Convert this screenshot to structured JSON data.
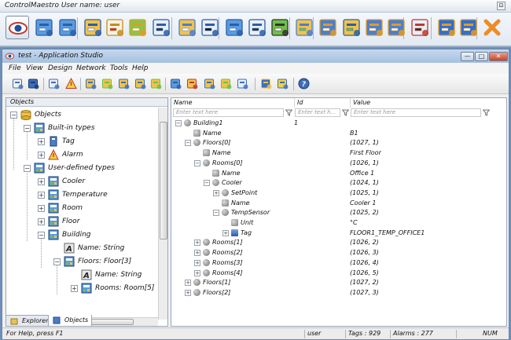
{
  "outer": {
    "title": "ControlMaestro User name: user",
    "close_glyph": "⊡",
    "toolbar_icons": [
      "eye-icon",
      "grid-icon",
      "grid-alt-icon",
      "monitor-icon",
      "document-icon",
      "chart-icon",
      "report-icon",
      "tag-add-icon",
      "database-icon",
      "server-icon",
      "list-icon",
      "module-icon",
      "component-icon",
      "network-icon",
      "table-icon",
      "user-icon",
      "users-icon",
      "settings-icon",
      "alert-user-icon",
      "lock-user-icon",
      "exit-icon"
    ]
  },
  "window": {
    "title": "test - Application Studio",
    "buttons": {
      "minimize": "—",
      "maximize": "□",
      "close": "✕"
    },
    "menu": [
      "File",
      "View",
      "Design",
      "Network",
      "Tools",
      "Help"
    ]
  },
  "left": {
    "header": "Objects",
    "tree": [
      {
        "label": "Objects",
        "level": 0,
        "icon": "objects-icon"
      },
      {
        "label": "Built-in types",
        "level": 1,
        "icon": "types-icon"
      },
      {
        "label": "Tag",
        "level": 2,
        "icon": "tag-icon"
      },
      {
        "label": "Alarm",
        "level": 2,
        "icon": "alarm-icon"
      },
      {
        "label": "User-defined types",
        "level": 1,
        "icon": "types-icon"
      },
      {
        "label": "Cooler",
        "level": 2,
        "icon": "type-icon"
      },
      {
        "label": "Temperature",
        "level": 2,
        "icon": "type-icon"
      },
      {
        "label": "Room",
        "level": 2,
        "icon": "type-icon"
      },
      {
        "label": "Floor",
        "level": 2,
        "icon": "type-icon"
      },
      {
        "label": "Building",
        "level": 2,
        "icon": "type-icon"
      },
      {
        "label": "Name: String",
        "level": 3,
        "icon": "string-icon"
      },
      {
        "label": "Floors: Floor[3]",
        "level": 3,
        "icon": "type-icon"
      },
      {
        "label": "Name: String",
        "level": 4,
        "icon": "string-icon"
      },
      {
        "label": "Rooms: Room[5]",
        "level": 4,
        "icon": "type-icon"
      }
    ],
    "tabs": [
      "Explorer",
      "Objects"
    ]
  },
  "grid": {
    "columns": [
      "Name",
      "Id",
      "Value"
    ],
    "filter_placeholders": [
      "Enter text here",
      "Enter text h...",
      "Enter text here"
    ],
    "rows": [
      {
        "name": "Building1",
        "id": "1",
        "value": "",
        "level": 0,
        "exp": "−",
        "kind": "object"
      },
      {
        "name": "Name",
        "id": "",
        "value": "B1",
        "level": 1,
        "exp": "",
        "kind": "attr"
      },
      {
        "name": "Floors[0]",
        "id": "",
        "value": "(1027, 1)",
        "level": 1,
        "exp": "−",
        "kind": "object"
      },
      {
        "name": "Name",
        "id": "",
        "value": "First Floor",
        "level": 2,
        "exp": "",
        "kind": "attr"
      },
      {
        "name": "Rooms[0]",
        "id": "",
        "value": "(1026, 1)",
        "level": 2,
        "exp": "−",
        "kind": "object"
      },
      {
        "name": "Name",
        "id": "",
        "value": "Office 1",
        "level": 3,
        "exp": "",
        "kind": "attr"
      },
      {
        "name": "Cooler",
        "id": "",
        "value": "(1024, 1)",
        "level": 3,
        "exp": "−",
        "kind": "object"
      },
      {
        "name": "SetPoint",
        "id": "",
        "value": "(1025, 1)",
        "level": 4,
        "exp": "+",
        "kind": "object"
      },
      {
        "name": "Name",
        "id": "",
        "value": "Cooler 1",
        "level": 4,
        "exp": "",
        "kind": "attr"
      },
      {
        "name": "TempSensor",
        "id": "",
        "value": "(1025, 2)",
        "level": 4,
        "exp": "−",
        "kind": "object"
      },
      {
        "name": "Unit",
        "id": "",
        "value": "°C",
        "level": 5,
        "exp": "",
        "kind": "attr"
      },
      {
        "name": "Tag",
        "id": "",
        "value": "FLOOR1_TEMP_OFFICE1",
        "level": 5,
        "exp": "+",
        "kind": "tag"
      },
      {
        "name": "Rooms[1]",
        "id": "",
        "value": "(1026, 2)",
        "level": 2,
        "exp": "+",
        "kind": "object"
      },
      {
        "name": "Rooms[2]",
        "id": "",
        "value": "(1026, 3)",
        "level": 2,
        "exp": "+",
        "kind": "object"
      },
      {
        "name": "Rooms[3]",
        "id": "",
        "value": "(1026, 4)",
        "level": 2,
        "exp": "+",
        "kind": "object"
      },
      {
        "name": "Rooms[4]",
        "id": "",
        "value": "(1026, 5)",
        "level": 2,
        "exp": "+",
        "kind": "object"
      },
      {
        "name": "Floors[1]",
        "id": "",
        "value": "(1027, 2)",
        "level": 1,
        "exp": "+",
        "kind": "object"
      },
      {
        "name": "Floors[2]",
        "id": "",
        "value": "(1027, 3)",
        "level": 1,
        "exp": "+",
        "kind": "object"
      }
    ]
  },
  "status": {
    "help": "For Help, press F1",
    "user": "user",
    "tags": "Tags : 929",
    "alarms": "Alarms : 277",
    "num": "NUM"
  }
}
